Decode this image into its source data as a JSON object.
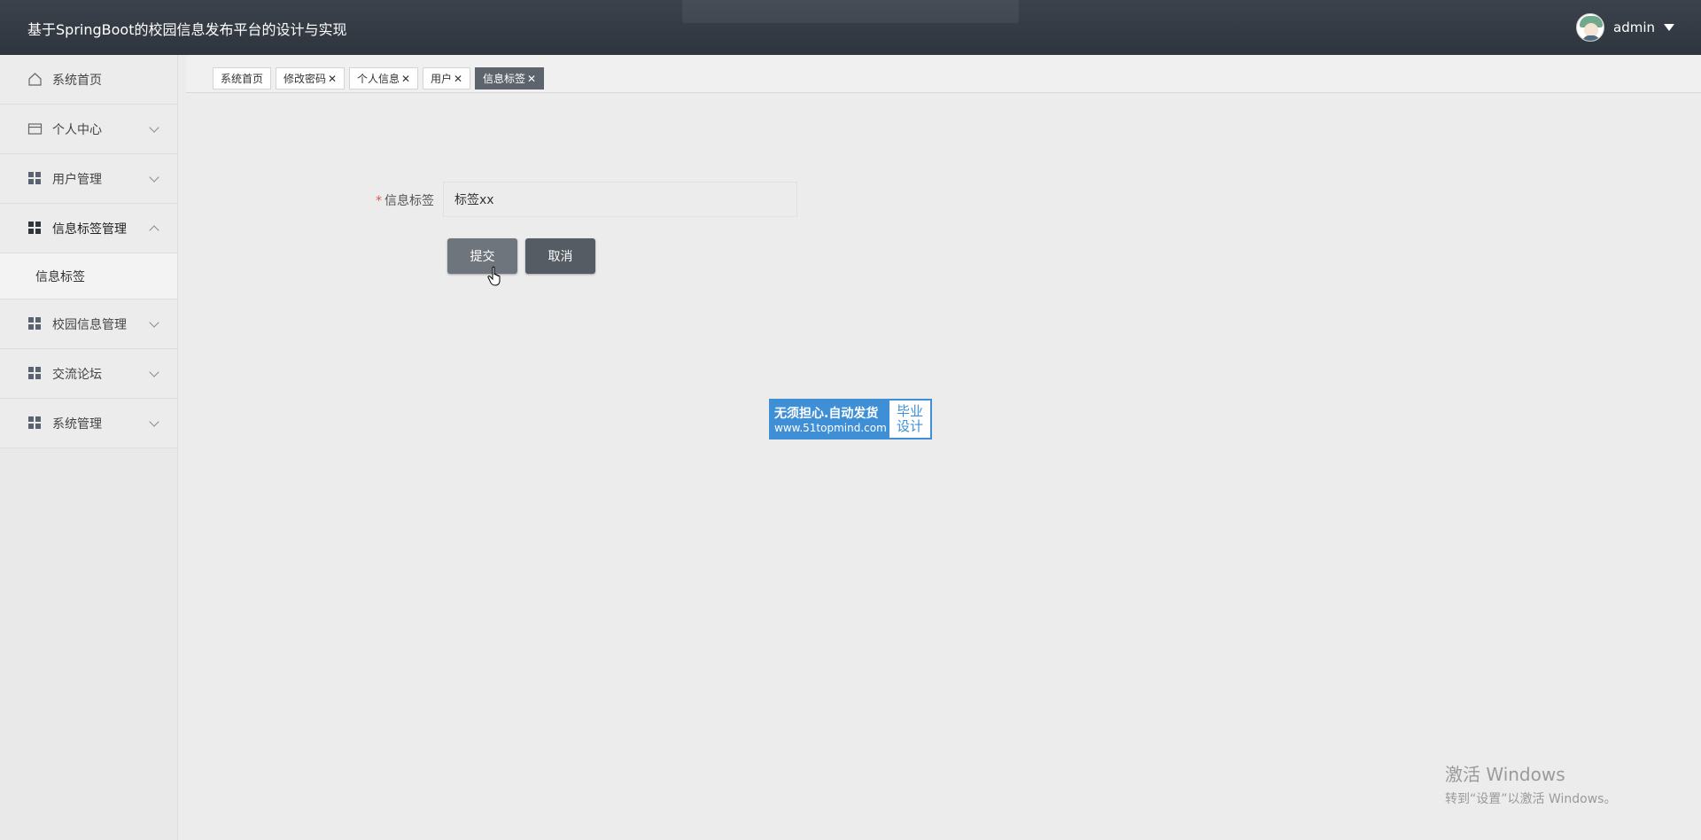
{
  "header": {
    "title": "基于SpringBoot的校园信息发布平台的设计与实现",
    "username": "admin"
  },
  "sidebar": {
    "items": [
      {
        "label": "系统首页",
        "icon": "home-icon"
      },
      {
        "label": "个人中心",
        "icon": "card-icon"
      },
      {
        "label": "用户管理",
        "icon": "grid-icon"
      },
      {
        "label": "信息标签管理",
        "icon": "grid-icon",
        "open": true,
        "children": [
          {
            "label": "信息标签"
          }
        ]
      },
      {
        "label": "校园信息管理",
        "icon": "grid-icon"
      },
      {
        "label": "交流论坛",
        "icon": "grid-icon"
      },
      {
        "label": "系统管理",
        "icon": "grid-icon"
      }
    ]
  },
  "tabs": [
    {
      "label": "系统首页",
      "closable": false
    },
    {
      "label": "修改密码",
      "closable": true
    },
    {
      "label": "个人信息",
      "closable": true
    },
    {
      "label": "用户",
      "closable": true
    },
    {
      "label": "信息标签",
      "closable": true,
      "active": true
    }
  ],
  "form": {
    "label": "信息标签",
    "required_mark": "*",
    "value": "标签xx",
    "submit": "提交",
    "cancel": "取消"
  },
  "watermark": {
    "line1": "无须担心.自动发货",
    "line2": "www.51topmind.com",
    "right1": "毕业",
    "right2": "设计"
  },
  "os": {
    "activate_title": "激活 Windows",
    "activate_sub": "转到“设置”以激活 Windows。"
  },
  "colors": {
    "header": "#353b44",
    "active_tab": "#5d646c",
    "submit": "#6f757d",
    "cancel": "#555c63",
    "watermark": "#3e8fd6"
  }
}
